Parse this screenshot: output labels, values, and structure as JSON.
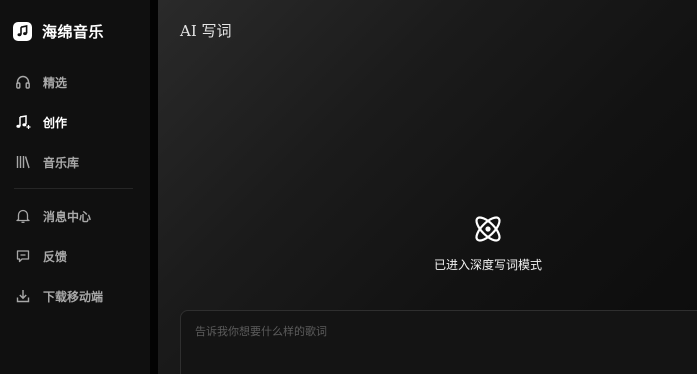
{
  "brand": {
    "name": "海绵音乐",
    "logo_icon": "music-note-icon"
  },
  "sidebar": {
    "items": [
      {
        "label": "精选",
        "icon": "headphones-icon",
        "active": false
      },
      {
        "label": "创作",
        "icon": "music-sparkle-icon",
        "active": true
      },
      {
        "label": "音乐库",
        "icon": "library-icon",
        "active": false
      },
      {
        "label": "消息中心",
        "icon": "bell-icon",
        "active": false
      },
      {
        "label": "反馈",
        "icon": "feedback-icon",
        "active": false
      },
      {
        "label": "下载移动端",
        "icon": "download-icon",
        "active": false
      }
    ]
  },
  "main": {
    "title": "AI 写词",
    "mode_icon": "atom-icon",
    "mode_text": "已进入深度写词模式",
    "prompt": {
      "placeholder": "告诉我你想要什么样的歌词",
      "value": ""
    }
  },
  "colors": {
    "background": "#0b0b0b",
    "sidebar": "#101010",
    "text_active": "#ffffff",
    "text_inactive": "#a8a8a8"
  }
}
